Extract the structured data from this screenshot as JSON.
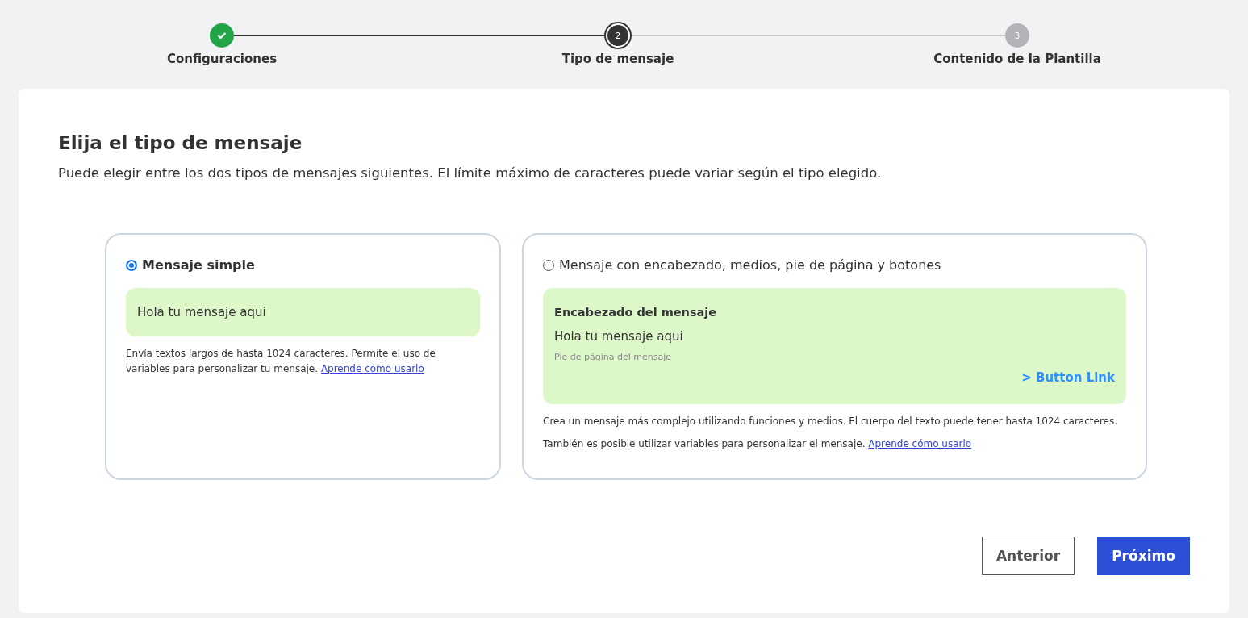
{
  "stepper": {
    "steps": [
      {
        "label": "Configuraciones",
        "completed": true,
        "selected": false
      },
      {
        "number": "2",
        "label": "Tipo de mensaje",
        "completed": false,
        "selected": true
      },
      {
        "number": "3",
        "label": "Contenido de la Plantilla",
        "completed": false,
        "selected": false
      }
    ]
  },
  "heading": "Elija el tipo de mensaje",
  "subheading": "Puede elegir entre los dos tipos de mensajes siguientes. El límite máximo de caracteres puede variar según el tipo elegido.",
  "options": [
    {
      "kind": "simple",
      "label": "Mensaje simple",
      "selected": true,
      "preview": {
        "body": "Hola tu mensaje aqui"
      },
      "description": [
        {
          "text": "Envía textos largos de hasta 1024 caracteres. Permite el uso de variables para personalizar tu mensaje.",
          "link": "Aprende cómo usarlo"
        }
      ]
    },
    {
      "kind": "rich",
      "label": "Mensaje con encabezado, medios, pie de página y botones",
      "selected": false,
      "preview": {
        "header": "Encabezado del mensaje",
        "body": "Hola tu mensaje aqui",
        "footer": "Pie de página del mensaje",
        "button": "> Button Link"
      },
      "description": [
        {
          "text": "Crea un mensaje más complejo utilizando funciones y medios. El cuerpo del texto puede tener hasta 1024 caracteres."
        },
        {
          "text": "También es posible utilizar variables para personalizar el mensaje.",
          "link": "Aprende cómo usarlo"
        }
      ]
    }
  ],
  "buttons": [
    {
      "kind": "secondary",
      "label": "Anterior"
    },
    {
      "kind": "primary",
      "label": "Próximo"
    }
  ]
}
